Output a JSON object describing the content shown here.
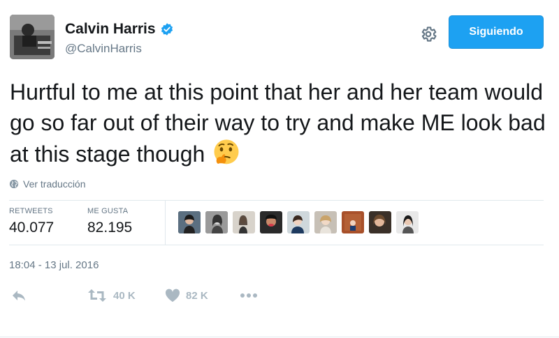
{
  "author": {
    "name": "Calvin Harris",
    "handle": "@CalvinHarris",
    "avatar_icon": "avatar-photo",
    "verified_icon": "verified-badge-icon"
  },
  "header": {
    "follow_label": "Siguiendo",
    "settings_icon": "gear-icon"
  },
  "tweet": {
    "text": "Hurtful to me at this point that her and her team would go so far out of their way to try and make ME look bad at this stage though",
    "emoji": "thinking-face-emoji",
    "translate_label": "Ver traducción"
  },
  "stats": {
    "retweets_label": "RETWEETS",
    "retweets_value": "40.077",
    "likes_label": "ME GUSTA",
    "likes_value": "82.195"
  },
  "likers_count_shown": 9,
  "timestamp": "18:04 - 13 jul. 2016",
  "actions": {
    "reply_icon": "reply-icon",
    "retweet_count": "40 K",
    "like_count": "82 K",
    "more_icon": "more-icon"
  },
  "colors": {
    "accent": "#1da1f2",
    "text": "#14171a",
    "secondary": "#657786",
    "action_gray": "#aab8c2"
  }
}
